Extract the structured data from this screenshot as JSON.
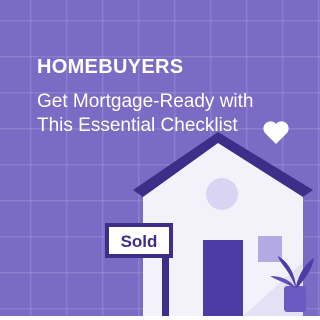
{
  "promo": {
    "category": "HOMEBUYERS",
    "headline": "Get Mortgage-Ready with This Essential Checklist",
    "sign_text": "Sold"
  },
  "colors": {
    "background": "#7a6bc4",
    "house_body": "#f3f2fb",
    "roof": "#3d2e8a",
    "door": "#4e3ca6",
    "sign_border": "#3d2e8a",
    "heart": "#ffffff"
  },
  "icons": [
    "heart-icon",
    "house-illustration",
    "sold-sign",
    "plant-icon"
  ]
}
